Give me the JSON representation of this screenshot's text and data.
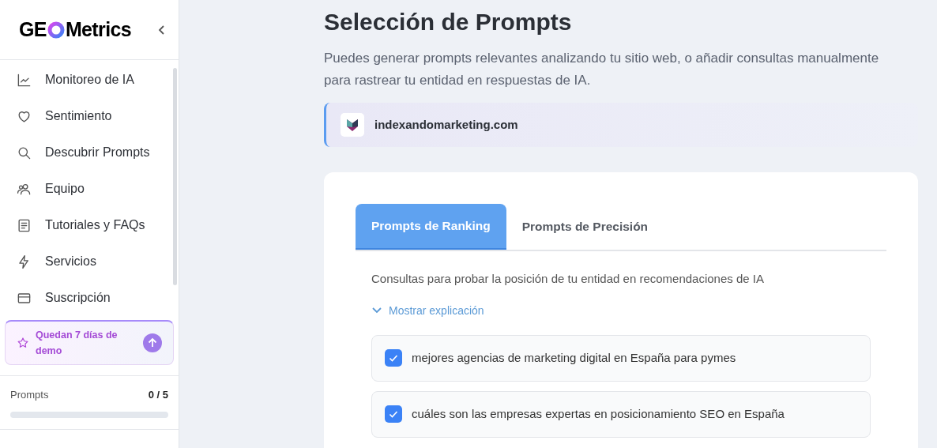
{
  "sidebar": {
    "logo": {
      "before": "GE",
      "after": "Metrics"
    },
    "nav": [
      {
        "label": "Monitoreo de IA",
        "kind": "chart"
      },
      {
        "label": "Sentimiento",
        "kind": "heart"
      },
      {
        "label": "Descubrir Prompts",
        "kind": "search"
      },
      {
        "label": "Equipo",
        "kind": "team"
      },
      {
        "label": "Tutoriales y FAQs",
        "kind": "book"
      },
      {
        "label": "Servicios",
        "kind": "bolt"
      },
      {
        "label": "Suscripción",
        "kind": "card"
      }
    ],
    "demo": {
      "text": "Quedan 7 días de demo"
    },
    "usage": {
      "label": "Prompts",
      "count": "0 / 5",
      "level": 0
    }
  },
  "main": {
    "title": "Selección de Prompts",
    "subtitle": "Puedes generar prompts relevantes analizando tu sitio web, o añadir consultas manualmente para rastrear tu entidad en respuestas de IA.",
    "domain": "indexandomarketing.com",
    "tabs": [
      {
        "label": "Prompts de Ranking",
        "selected": true
      },
      {
        "label": "Prompts de Precisión",
        "selected": false
      }
    ],
    "description": "Consultas para probar la posición de tu entidad en recomendaciones de IA",
    "toggle": "Mostrar explicación",
    "prompts": [
      {
        "text": "mejores agencias de marketing digital en España para pymes",
        "checked": true
      },
      {
        "text": "cuáles son las empresas expertas en posicionamiento SEO en España",
        "checked": true
      }
    ]
  }
}
